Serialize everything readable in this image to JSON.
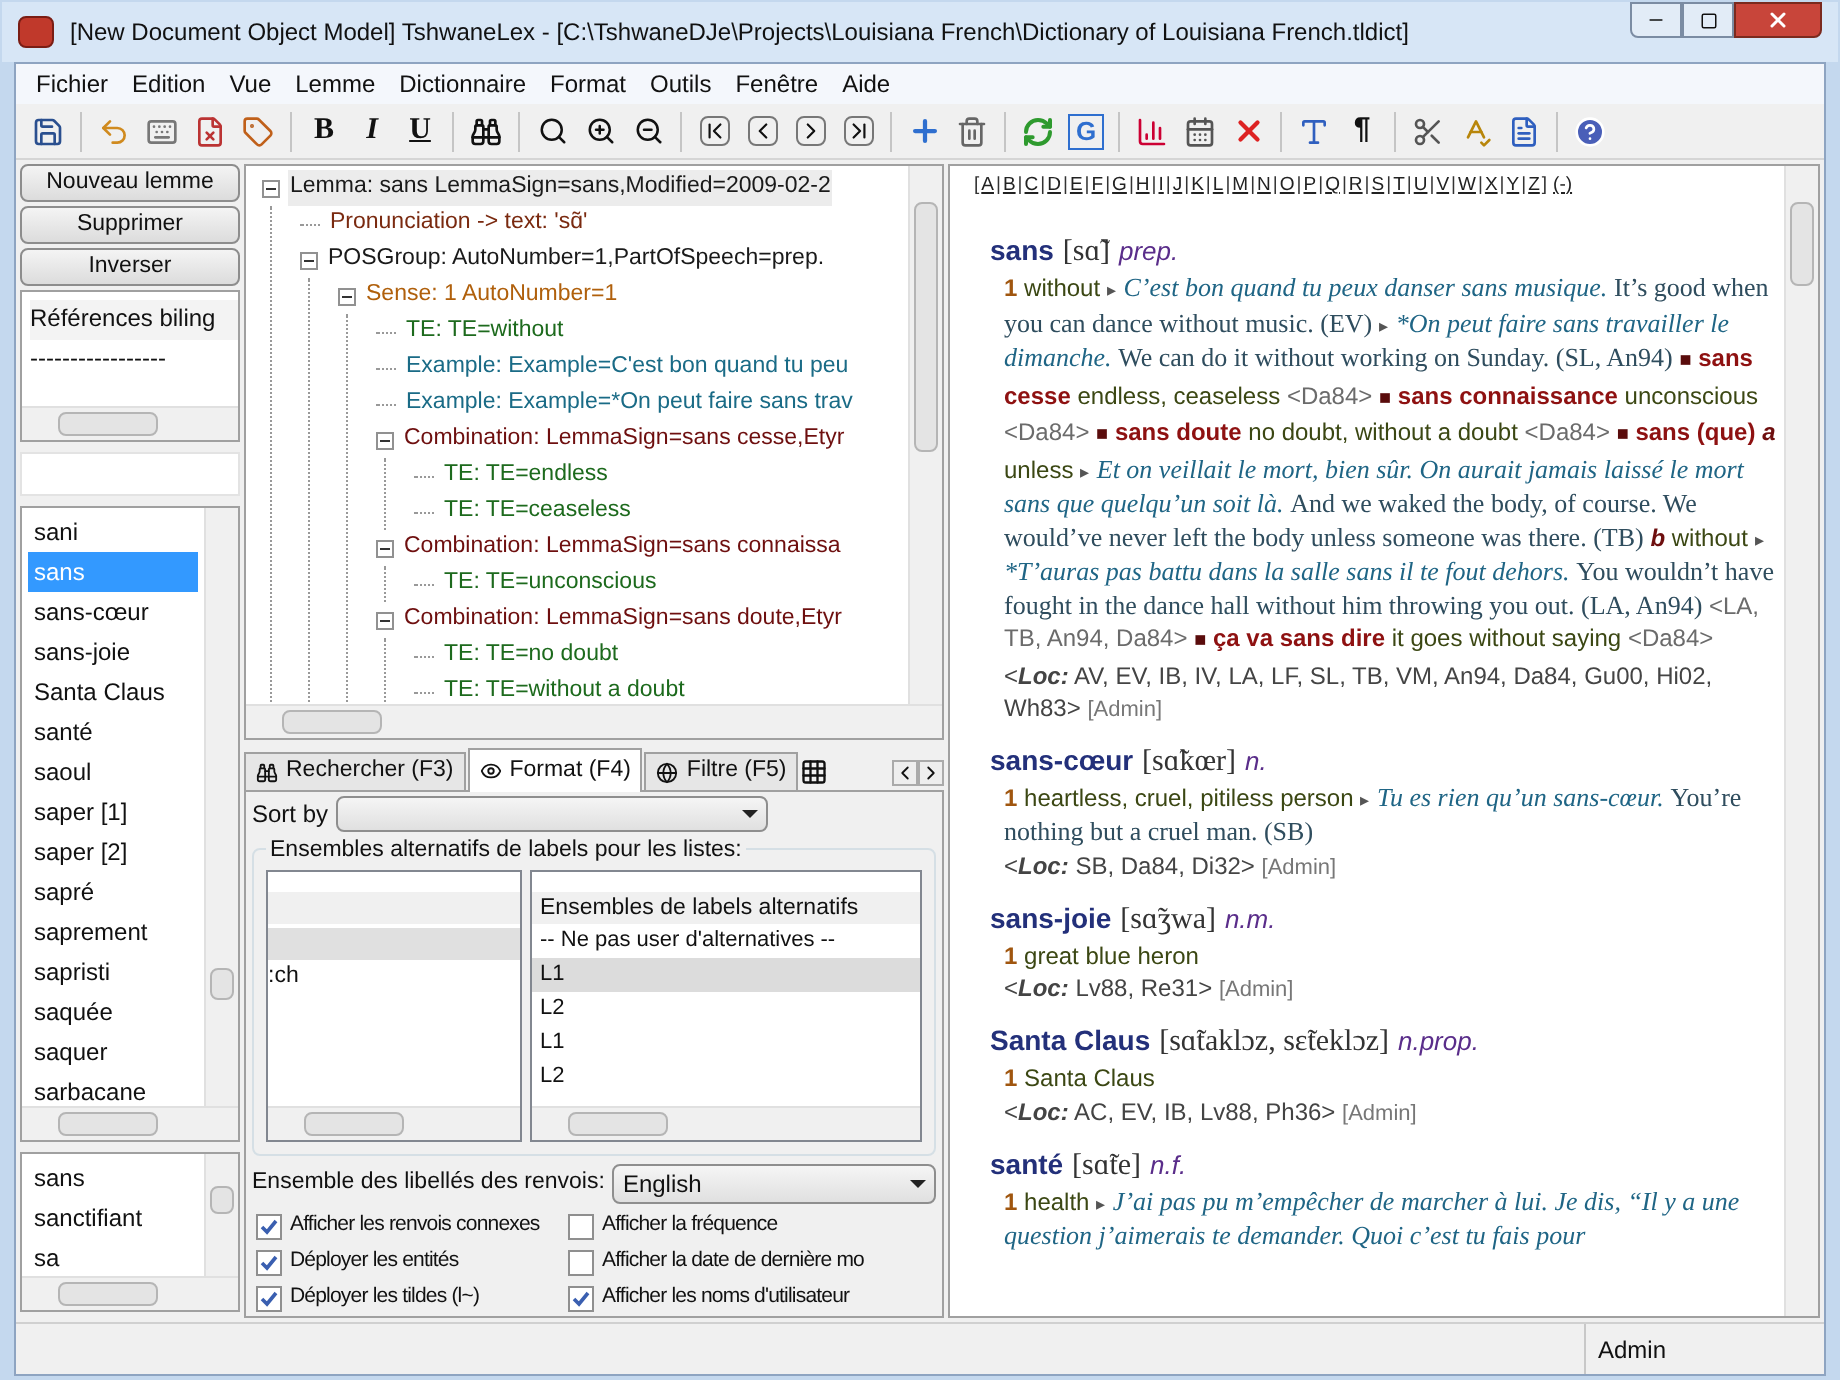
{
  "window": {
    "title": "[New Document Object Model] TshwaneLex - [C:\\TshwaneDJe\\Projects\\Louisiana French\\Dictionary of Louisiana French.tldict]"
  },
  "menu": [
    "Fichier",
    "Edition",
    "Vue",
    "Lemme",
    "Dictionnaire",
    "Format",
    "Outils",
    "Fenêtre",
    "Aide"
  ],
  "toolbar": {
    "text_buttons": [
      "B",
      "I",
      "U"
    ],
    "g_button": "G",
    "pilcrow_button": "¶"
  },
  "left": {
    "buttons": [
      "Nouveau lemme",
      "Supprimer",
      "Inverser"
    ],
    "references": [
      "Références biling",
      "-----------------"
    ],
    "lemmas": [
      {
        "text": "sani",
        "selected": false
      },
      {
        "text": "sans",
        "selected": true
      },
      {
        "text": "sans-cœur",
        "selected": false
      },
      {
        "text": "sans-joie",
        "selected": false
      },
      {
        "text": "Santa Claus",
        "selected": false
      },
      {
        "text": "santé",
        "selected": false
      },
      {
        "text": "saoul",
        "selected": false
      },
      {
        "text": "saper [1]",
        "selected": false
      },
      {
        "text": "saper [2]",
        "selected": false
      },
      {
        "text": "sapré",
        "selected": false
      },
      {
        "text": "saprement",
        "selected": false
      },
      {
        "text": "sapristi",
        "selected": false
      },
      {
        "text": "saquée",
        "selected": false
      },
      {
        "text": "saquer",
        "selected": false
      },
      {
        "text": "sarbacane",
        "selected": false
      }
    ],
    "history": [
      "sans",
      "sanctifiant",
      "sa"
    ]
  },
  "tree": [
    {
      "kind": "lemma",
      "label": "Lemma: sans  LemmaSign=sans,Modified=2009-02-2",
      "selected": true,
      "expanded": true,
      "children": [
        {
          "kind": "pron",
          "label": "Pronunciation -> text: 'sɑ̃'",
          "selected": false
        },
        {
          "kind": "pos",
          "label": "POSGroup:  AutoNumber=1,PartOfSpeech=prep.",
          "selected": false,
          "expanded": true,
          "children": [
            {
              "kind": "sense",
              "label": "Sense: 1  AutoNumber=1",
              "selected": false,
              "expanded": true,
              "children": [
                {
                  "kind": "te",
                  "label": "TE:  TE=without",
                  "selected": false
                },
                {
                  "kind": "example",
                  "label": "Example:  Example=C'est bon quand tu peu",
                  "selected": false
                },
                {
                  "kind": "example",
                  "label": "Example:  Example=*On peut faire sans trav",
                  "selected": false
                },
                {
                  "kind": "comb",
                  "label": "Combination:  LemmaSign=sans cesse,Etyr",
                  "selected": false,
                  "expanded": true,
                  "children": [
                    {
                      "kind": "te",
                      "label": "TE:  TE=endless",
                      "selected": false
                    },
                    {
                      "kind": "te",
                      "label": "TE:  TE=ceaseless",
                      "selected": false
                    }
                  ]
                },
                {
                  "kind": "comb",
                  "label": "Combination:  LemmaSign=sans connaissa",
                  "selected": false,
                  "expanded": true,
                  "children": [
                    {
                      "kind": "te",
                      "label": "TE:  TE=unconscious",
                      "selected": false
                    }
                  ]
                },
                {
                  "kind": "comb",
                  "label": "Combination:  LemmaSign=sans doute,Etyr",
                  "selected": false,
                  "expanded": true,
                  "children": [
                    {
                      "kind": "te",
                      "label": "TE:  TE=no doubt",
                      "selected": false
                    },
                    {
                      "kind": "te",
                      "label": "TE:  TE=without a doubt",
                      "selected": false
                    }
                  ]
                }
              ]
            }
          ]
        }
      ]
    }
  ],
  "tabs": [
    {
      "label": "Rechercher (F3)",
      "selected": false
    },
    {
      "label": "Format (F4)",
      "selected": true
    },
    {
      "label": "Filtre (F5)",
      "selected": false
    }
  ],
  "format": {
    "sort_label": "Sort by",
    "group_title": "Ensembles alternatifs de labels pour les listes:",
    "left_rows": [
      ":ch"
    ],
    "right_header": "Ensembles de labels alternatifs",
    "right_rows": [
      {
        "text": "-- Ne pas user d'alternatives --",
        "selected": false
      },
      {
        "text": "L1",
        "selected": true
      },
      {
        "text": "L2",
        "selected": false
      },
      {
        "text": "L1",
        "selected": false
      },
      {
        "text": "L2",
        "selected": false
      }
    ],
    "xref_label": "Ensemble des libellés des renvois:",
    "xref_value": "English",
    "checkboxes": [
      {
        "label": "Afficher les renvois connexes",
        "checked": true
      },
      {
        "label": "Afficher la fréquence",
        "checked": false
      },
      {
        "label": "Déployer les entités",
        "checked": true
      },
      {
        "label": "Afficher la date de dernière mo",
        "checked": false
      },
      {
        "label": "Déployer les tildes (l~)",
        "checked": true
      },
      {
        "label": "Afficher les noms d'utilisateur",
        "checked": true
      }
    ]
  },
  "alphabet": [
    {
      "before": "[",
      "letter": "A",
      "after": "|"
    },
    {
      "letter": "B",
      "after": "|"
    },
    {
      "letter": "C",
      "after": "|"
    },
    {
      "letter": "D",
      "after": "|"
    },
    {
      "letter": "E",
      "after": "|"
    },
    {
      "letter": "F",
      "after": "|"
    },
    {
      "letter": "G",
      "after": "|"
    },
    {
      "letter": "H",
      "after": "|"
    },
    {
      "letter": "I",
      "after": "|"
    },
    {
      "letter": "J",
      "after": "|"
    },
    {
      "letter": "K",
      "after": "|"
    },
    {
      "letter": "L",
      "after": "|"
    },
    {
      "letter": "M",
      "after": "|"
    },
    {
      "letter": "N",
      "after": "|"
    },
    {
      "letter": "O",
      "after": "|"
    },
    {
      "letter": "P",
      "after": "|"
    },
    {
      "letter": "Q",
      "after": "|"
    },
    {
      "letter": "R",
      "after": "|"
    },
    {
      "letter": "S",
      "after": "|"
    },
    {
      "letter": "T",
      "after": "|"
    },
    {
      "letter": "U",
      "after": "|"
    },
    {
      "letter": "V",
      "after": "|"
    },
    {
      "letter": "W",
      "after": "|"
    },
    {
      "letter": "X",
      "after": "|"
    },
    {
      "letter": "Y",
      "after": "|"
    },
    {
      "letter": "Z",
      "after": "]"
    }
  ],
  "alphabet_extra": "(-)",
  "entries": [
    {
      "head": [
        {
          "kind": "hw",
          "text": "sans"
        },
        {
          "kind": "pron",
          "text": "[sɑ̃]"
        },
        {
          "kind": "pos",
          "text": "prep."
        }
      ],
      "body": [
        {
          "kind": "num",
          "text": "1"
        },
        {
          "kind": "gloss",
          "text": "without"
        },
        {
          "kind": "arrow",
          "text": "▸"
        },
        {
          "kind": "ex",
          "text": "C’est bon quand tu peux danser sans musique."
        },
        {
          "kind": "tr",
          "text": "It’s good when you can dance without music. (EV)"
        },
        {
          "kind": "arrow",
          "text": "▸"
        },
        {
          "kind": "ex",
          "text": "*On peut faire sans travailler le dimanche."
        },
        {
          "kind": "tr",
          "text": "We can do it without working on Sunday. (SL, An94)"
        },
        {
          "kind": "bullet",
          "text": "■"
        },
        {
          "kind": "comb",
          "text": "sans cesse"
        },
        {
          "kind": "gloss",
          "text": "endless, ceaseless"
        },
        {
          "kind": "src",
          "text": "<Da84>"
        },
        {
          "kind": "bullet",
          "text": "■"
        },
        {
          "kind": "comb",
          "text": "sans connaissance"
        },
        {
          "kind": "gloss",
          "text": "unconscious"
        },
        {
          "kind": "src",
          "text": "<Da84>"
        },
        {
          "kind": "bullet",
          "text": "■"
        },
        {
          "kind": "comb",
          "text": "sans doute"
        },
        {
          "kind": "gloss",
          "text": "no doubt, without a doubt"
        },
        {
          "kind": "src",
          "text": "<Da84>"
        },
        {
          "kind": "bullet",
          "text": "■"
        },
        {
          "kind": "comb",
          "text": "sans (que)"
        },
        {
          "kind": "sub",
          "text": "a"
        },
        {
          "kind": "gloss",
          "text": "unless"
        },
        {
          "kind": "arrow",
          "text": "▸"
        },
        {
          "kind": "ex",
          "text": "Et on veillait le mort, bien sûr. On aurait jamais laissé le mort sans que quelqu’un soit là."
        },
        {
          "kind": "tr",
          "text": "And we waked the body, of course. We would’ve never left the body unless someone was there. (TB)"
        },
        {
          "kind": "sub",
          "text": "b"
        },
        {
          "kind": "gloss",
          "text": "without"
        },
        {
          "kind": "arrow",
          "text": "▸"
        },
        {
          "kind": "ex",
          "text": "*T’auras pas battu dans la salle sans il te fout dehors."
        },
        {
          "kind": "tr",
          "text": "You wouldn’t have fought in the dance hall without him throwing you out. (LA, An94)"
        },
        {
          "kind": "src",
          "text": "<LA, TB, An94, Da84>"
        },
        {
          "kind": "bullet",
          "text": "■"
        },
        {
          "kind": "comb",
          "text": "ça va sans dire"
        },
        {
          "kind": "gloss",
          "text": "it goes without saying"
        },
        {
          "kind": "src",
          "text": "<Da84>"
        }
      ],
      "loc": {
        "open": "<",
        "label": "Loc:",
        "text": "AV, EV, IB, IV, LA, LF, SL, TB, VM, An94, Da84, Gu00, Hi02, Wh83>",
        "user": "[Admin]"
      }
    },
    {
      "head": [
        {
          "kind": "hw",
          "text": "sans-cœur"
        },
        {
          "kind": "pron",
          "text": "[sɑ̃kœr]"
        },
        {
          "kind": "pos",
          "text": "n."
        }
      ],
      "body": [
        {
          "kind": "num",
          "text": "1"
        },
        {
          "kind": "gloss",
          "text": "heartless, cruel, pitiless person"
        },
        {
          "kind": "arrow",
          "text": "▸"
        },
        {
          "kind": "ex",
          "text": "Tu es rien qu’un sans-cœur."
        },
        {
          "kind": "tr",
          "text": "You’re nothing but a cruel man. (SB)"
        }
      ],
      "loc": {
        "open": "<",
        "label": "Loc:",
        "text": "SB, Da84, Di32>",
        "user": "[Admin]"
      }
    },
    {
      "head": [
        {
          "kind": "hw",
          "text": "sans-joie"
        },
        {
          "kind": "pron",
          "text": "[sɑ̃ʒwa]"
        },
        {
          "kind": "pos",
          "text": "n.m."
        }
      ],
      "body": [
        {
          "kind": "num",
          "text": "1"
        },
        {
          "kind": "gloss",
          "text": "great blue heron"
        }
      ],
      "loc": {
        "open": "<",
        "label": "Loc:",
        "text": "Lv88, Re31>",
        "user": "[Admin]"
      }
    },
    {
      "head": [
        {
          "kind": "hw",
          "text": "Santa Claus"
        },
        {
          "kind": "pron",
          "text": "[sɑ̃taklɔz, sɛ̃teklɔz]"
        },
        {
          "kind": "pos",
          "text": "n.prop."
        }
      ],
      "body": [
        {
          "kind": "num",
          "text": "1"
        },
        {
          "kind": "gloss",
          "text": "Santa Claus"
        }
      ],
      "loc": {
        "open": "<",
        "label": "Loc:",
        "text": "AC, EV, IB, Lv88, Ph36>",
        "user": "[Admin]"
      }
    },
    {
      "head": [
        {
          "kind": "hw",
          "text": "santé"
        },
        {
          "kind": "pron",
          "text": "[sɑ̃te]"
        },
        {
          "kind": "pos",
          "text": "n.f."
        }
      ],
      "body": [
        {
          "kind": "num",
          "text": "1"
        },
        {
          "kind": "gloss",
          "text": "health"
        },
        {
          "kind": "arrow",
          "text": "▸"
        },
        {
          "kind": "ex",
          "text": "J’ai pas pu m’empêcher de marcher à lui. Je dis, “Il y a une question j’aimerais te demander. Quoi c’est tu fais pour"
        }
      ]
    }
  ],
  "status_bar": {
    "user": "Admin"
  }
}
